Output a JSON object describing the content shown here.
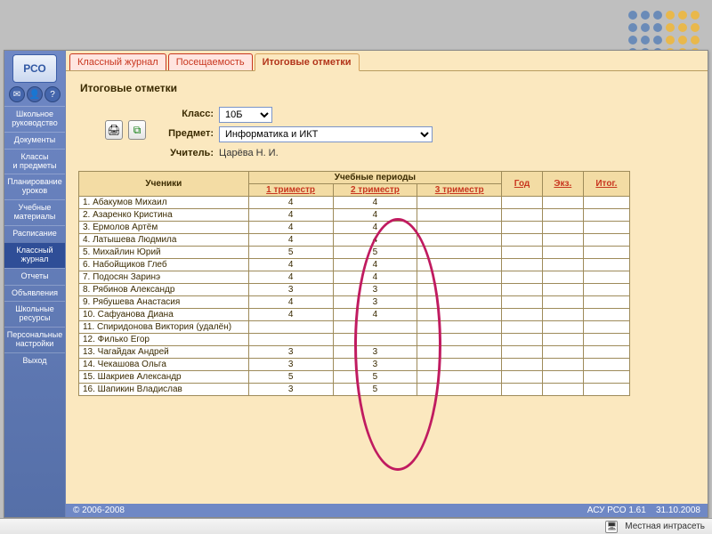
{
  "brand": "РСО",
  "sidebar": {
    "items": [
      {
        "label": "Школьное\nруководство"
      },
      {
        "label": "Документы"
      },
      {
        "label": "Классы\nи предметы"
      },
      {
        "label": "Планирование\nуроков"
      },
      {
        "label": "Учебные\nматериалы"
      },
      {
        "label": "Расписание"
      },
      {
        "label": "Классный\nжурнал"
      },
      {
        "label": "Отчеты"
      },
      {
        "label": "Объявления"
      },
      {
        "label": "Школьные\nресурсы"
      },
      {
        "label": "Персональные\nнастройки"
      },
      {
        "label": "Выход"
      }
    ],
    "active_index": 6
  },
  "tabs": [
    {
      "label": "Классный журнал"
    },
    {
      "label": "Посещаемость"
    },
    {
      "label": "Итоговые отметки"
    }
  ],
  "active_tab_index": 2,
  "page_title": "Итоговые отметки",
  "filters": {
    "class_label": "Класс:",
    "class_value": "10Б",
    "subject_label": "Предмет:",
    "subject_value": "Информатика и ИКТ",
    "teacher_label": "Учитель:",
    "teacher_value": "Царёва Н. И."
  },
  "columns": {
    "students": "Ученики",
    "periods_group": "Учебные периоды",
    "periods": [
      "1 триместр",
      "2 триместр",
      "3 триместр"
    ],
    "year": "Год",
    "exam": "Экз.",
    "final": "Итог."
  },
  "rows": [
    {
      "n": 1,
      "name": "Абакумов Михаил",
      "g": [
        "4",
        "4",
        "",
        "",
        "",
        ""
      ]
    },
    {
      "n": 2,
      "name": "Азаренко Кристина",
      "g": [
        "4",
        "4",
        "",
        "",
        "",
        ""
      ]
    },
    {
      "n": 3,
      "name": "Ермолов Артём",
      "g": [
        "4",
        "4",
        "",
        "",
        "",
        ""
      ]
    },
    {
      "n": 4,
      "name": "Латышева Людмила",
      "g": [
        "4",
        "4",
        "",
        "",
        "",
        ""
      ]
    },
    {
      "n": 5,
      "name": "Михайлин Юрий",
      "g": [
        "5",
        "5",
        "",
        "",
        "",
        ""
      ]
    },
    {
      "n": 6,
      "name": "Набойщиков Глеб",
      "g": [
        "4",
        "4",
        "",
        "",
        "",
        ""
      ]
    },
    {
      "n": 7,
      "name": "Подосян Заринэ",
      "g": [
        "4",
        "4",
        "",
        "",
        "",
        ""
      ]
    },
    {
      "n": 8,
      "name": "Рябинов Александр",
      "g": [
        "3",
        "3",
        "",
        "",
        "",
        ""
      ]
    },
    {
      "n": 9,
      "name": "Рябушева Анастасия",
      "g": [
        "4",
        "3",
        "",
        "",
        "",
        ""
      ]
    },
    {
      "n": 10,
      "name": "Сафуанова Диана",
      "g": [
        "4",
        "4",
        "",
        "",
        "",
        ""
      ]
    },
    {
      "n": 11,
      "name": "Спиридонова Виктория (удалён)",
      "g": [
        "",
        "",
        "",
        "",
        "",
        ""
      ]
    },
    {
      "n": 12,
      "name": "Филько Егор",
      "g": [
        "",
        "",
        "",
        "",
        "",
        ""
      ]
    },
    {
      "n": 13,
      "name": "Чагайдак Андрей",
      "g": [
        "3",
        "3",
        "",
        "",
        "",
        ""
      ]
    },
    {
      "n": 14,
      "name": "Чекашова Ольга",
      "g": [
        "3",
        "3",
        "",
        "",
        "",
        ""
      ]
    },
    {
      "n": 15,
      "name": "Шакриев Александр",
      "g": [
        "5",
        "5",
        "",
        "",
        "",
        ""
      ]
    },
    {
      "n": 16,
      "name": "Шапикин Владислав",
      "g": [
        "3",
        "5",
        "",
        "",
        "",
        ""
      ]
    }
  ],
  "footer": {
    "copyright": "© 2006-2008",
    "version": "АСУ РСО 1.61",
    "date": "31.10.2008"
  },
  "statusbar": {
    "zone": "Местная интрасеть"
  },
  "dot_colors": [
    "#6a8bb8",
    "#6a8bb8",
    "#6a8bb8",
    "#e9b84b",
    "#e9b84b",
    "#e9b84b"
  ]
}
